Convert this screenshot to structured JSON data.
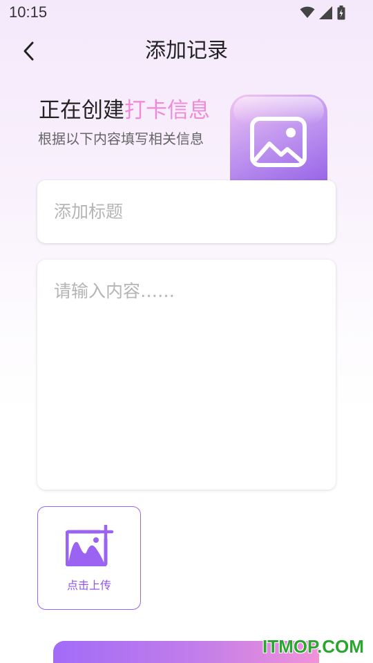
{
  "status_bar": {
    "time": "10:15",
    "icons": [
      "wifi-icon",
      "signal-icon",
      "battery-icon"
    ]
  },
  "nav": {
    "back_icon": "chevron-left-icon",
    "title": "添加记录"
  },
  "header": {
    "heading_prefix": "正在创建",
    "heading_accent": "打卡信息",
    "subheading": "根据以下内容填写相关信息",
    "image_icon": "image-icon"
  },
  "form": {
    "title_placeholder": "添加标题",
    "title_value": "",
    "content_placeholder": "请输入内容……",
    "content_value": "",
    "upload_label": "点击上传",
    "upload_icon": "add-image-icon"
  },
  "watermark": "ITMOP.COM",
  "colors": {
    "accent_pink": "#ef8ad8",
    "accent_purple": "#9a63f2",
    "gradient_start": "#a26bf8",
    "gradient_end": "#f192d9",
    "watermark_green": "#2aa52f"
  }
}
